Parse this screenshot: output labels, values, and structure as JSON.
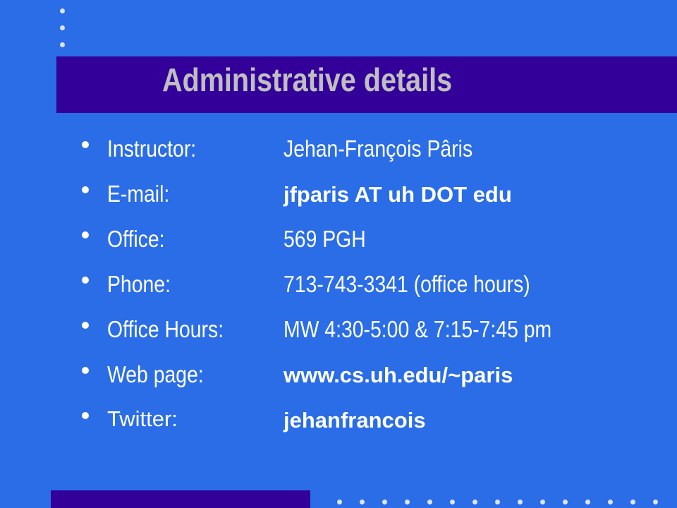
{
  "slide": {
    "title": "Administrative details",
    "colors": {
      "background": "#2a6de6",
      "title_bar": "#330099",
      "title_text": "#bfbfbf",
      "body_text": "#ffffff"
    },
    "items": [
      {
        "label": "Instructor:",
        "value": "Jehan-François Pâris"
      },
      {
        "label": "E-mail:",
        "value": " jfparis AT uh DOT edu"
      },
      {
        "label": "Office:",
        "value": "569 PGH"
      },
      {
        "label": "Phone:",
        "value": "713-743-3341 (office hours)"
      },
      {
        "label": "Office Hours:",
        "value": "MW 4:30-5:00 & 7:15-7:45 pm"
      },
      {
        "label": "Web page:",
        "value": "www.cs.uh.edu/~paris"
      },
      {
        "label": "Twitter:",
        "value": "jehanfrancois"
      }
    ]
  }
}
